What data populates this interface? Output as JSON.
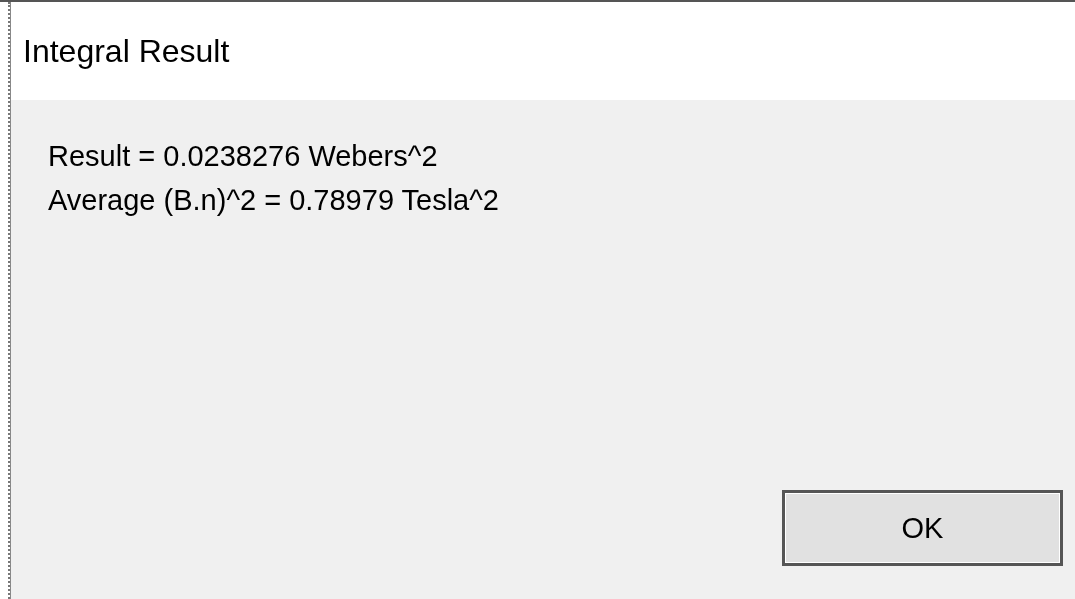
{
  "window": {
    "title": "Integral Result"
  },
  "message": [
    "Result = 0.0238276 Webers^2",
    "Average (B.n)^2 = 0.78979 Tesla^2"
  ],
  "buttons": [
    {
      "label": "OK",
      "selected": true
    }
  ]
}
